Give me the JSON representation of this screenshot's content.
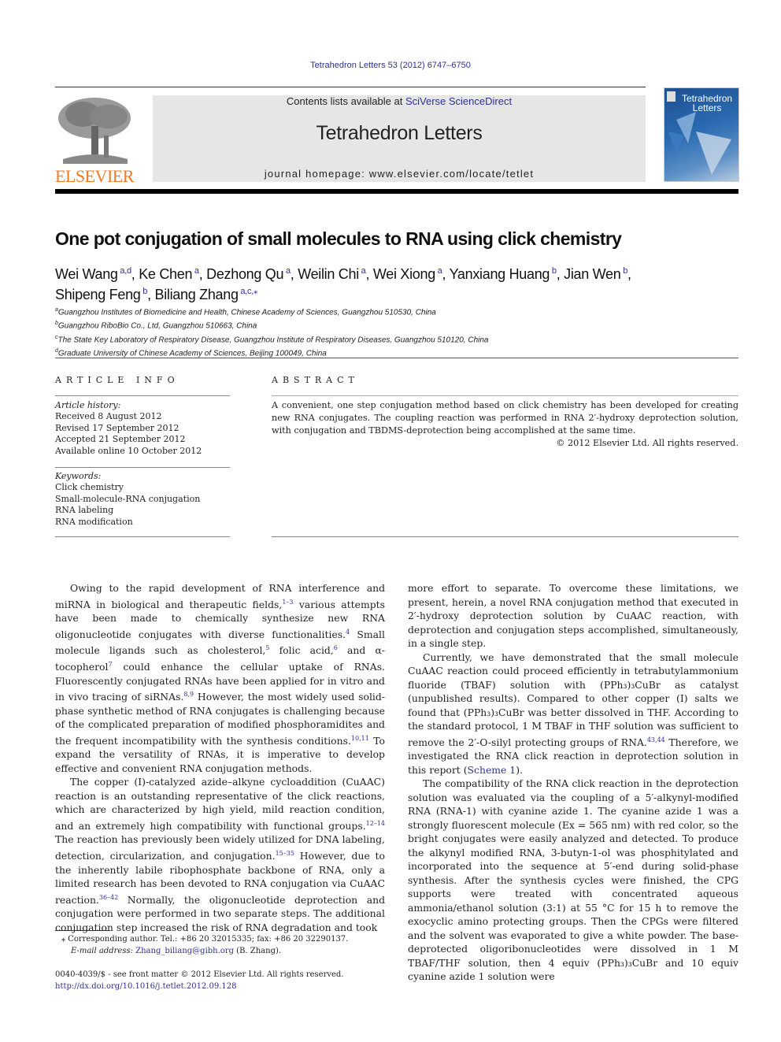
{
  "journal_header": {
    "citation": "Tetrahedron Letters 53 (2012) 6747–6750",
    "contents_prefix": "Contents lists available at ",
    "contents_link": "SciVerse ScienceDirect",
    "journal_title": "Tetrahedron Letters",
    "homepage_prefix": "journal homepage: ",
    "homepage_url": "www.elsevier.com/locate/tetlet",
    "publisher_logo_text": "ELSEVIER",
    "cover_title_line1": "Tetrahedron",
    "cover_title_line2": "Letters",
    "colors": {
      "link": "#2e3192",
      "elsevier_orange": "#f47920",
      "band": "#e6e6e6"
    }
  },
  "article": {
    "title": "One pot conjugation of small molecules to RNA using click chemistry",
    "authors": [
      {
        "name": "Wei Wang",
        "sup": "a,d"
      },
      {
        "name": "Ke Chen",
        "sup": "a"
      },
      {
        "name": "Dezhong Qu",
        "sup": "a"
      },
      {
        "name": "Weilin Chi",
        "sup": "a"
      },
      {
        "name": "Wei Xiong",
        "sup": "a"
      },
      {
        "name": "Yanxiang Huang",
        "sup": "b"
      },
      {
        "name": "Jian Wen",
        "sup": "b"
      },
      {
        "name": "Shipeng Feng",
        "sup": "b"
      },
      {
        "name": "Biliang Zhang",
        "sup": "a,c,⁎"
      }
    ],
    "affiliations": [
      {
        "mark": "a",
        "text": "Guangzhou Institutes of Biomedicine and Health, Chinese Academy of Sciences, Guangzhou 510530, China"
      },
      {
        "mark": "b",
        "text": "Guangzhou RiboBio Co., Ltd, Guangzhou 510663, China"
      },
      {
        "mark": "c",
        "text": "The State Key Laboratory of Respiratory Disease, Guangzhou Institute of Respiratory Diseases, Guangzhou 510120, China"
      },
      {
        "mark": "d",
        "text": "Graduate University of Chinese Academy of Sciences, Beijing 100049, China"
      }
    ]
  },
  "article_info": {
    "heading": "ARTICLE INFO",
    "history_label": "Article history:",
    "history": [
      "Received 8 August 2012",
      "Revised 17 September 2012",
      "Accepted 21 September 2012",
      "Available online 10 October 2012"
    ],
    "keywords_label": "Keywords:",
    "keywords": [
      "Click chemistry",
      "Small-molecule-RNA conjugation",
      "RNA labeling",
      "RNA modification"
    ]
  },
  "abstract": {
    "heading": "ABSTRACT",
    "text": "A convenient, one step conjugation method based on click chemistry has been developed for creating new RNA conjugates. The coupling reaction was performed in RNA 2′-hydroxy deprotection solution, with conjugation and TBDMS-deprotection being accomplished at the same time.",
    "copyright": "© 2012 Elsevier Ltd. All rights reserved."
  },
  "body": {
    "left": {
      "p1": [
        "Owing to the rapid development of RNA interference and miRNA in biological and therapeutic fields,",
        "1–3",
        " various attempts have been made to chemically synthesize new RNA oligonucleotide conjugates with diverse functionalities.",
        "4",
        " Small molecule ligands such as cholesterol,",
        "5",
        " folic acid,",
        "6",
        " and α-tocopherol",
        "7",
        " could enhance the cellular uptake of RNAs. Fluorescently conjugated RNAs have been applied for in vitro and in vivo tracing of siRNAs.",
        "8,9",
        " However, the most widely used solid-phase synthetic method of RNA conjugates is challenging because of the complicated preparation of modified phosphoramidites and the frequent incompatibility with the synthesis conditions.",
        "10,11",
        " To expand the versatility of RNAs, it is imperative to develop effective and convenient RNA conjugation methods."
      ],
      "p2": [
        "The copper (I)-catalyzed azide–alkyne cycloaddition (CuAAC) reaction is an outstanding representative of the click reactions, which are characterized by high yield, mild reaction condition, and an extremely high compatibility with functional groups.",
        "12–14",
        " The reaction has previously been widely utilized for DNA labeling, detection, circularization, and conjugation.",
        "15–35",
        " However, due to the inherently labile ribophosphate backbone of RNA, only a limited research has been devoted to RNA conjugation via CuAAC reaction.",
        "36–42",
        " Normally, the oligonucleotide deprotection and conjugation were performed in two separate steps. The additional conjugation step increased the risk of RNA degradation and took"
      ]
    },
    "right": {
      "p1": "more effort to separate. To overcome these limitations, we present, herein, a novel RNA conjugation method that executed in 2′-hydroxy deprotection solution by CuAAC reaction, with deprotection and conjugation steps accomplished, simultaneously, in a single step.",
      "p2": [
        "Currently, we have demonstrated that the small molecule CuAAC reaction could proceed efficiently in tetrabutylammonium fluoride (TBAF) solution with (PPh₃)₃CuBr as catalyst (unpublished results). Compared to other copper (I) salts we found that (PPh₃)₃CuBr was better dissolved in THF. According to the standard protocol, 1 M TBAF in THF solution was sufficient to remove the 2′-O-silyl protecting groups of RNA.",
        "43,44",
        " Therefore, we investigated the RNA click reaction in deprotection solution in this report (",
        "Scheme 1",
        ")."
      ],
      "p3": "The compatibility of the RNA click reaction in the deprotection solution was evaluated via the coupling of a 5′-alkynyl-modified RNA (RNA-1) with cyanine azide 1. The cyanine azide 1 was a strongly fluorescent molecule (Ex = 565 nm) with red color, so the bright conjugates were easily analyzed and detected. To produce the alkynyl modified RNA, 3-butyn-1-ol was phosphitylated and incorporated into the sequence at 5′-end during solid-phase synthesis. After the synthesis cycles were finished, the CPG supports were treated with concentrated aqueous ammonia/ethanol solution (3:1) at 55 °C for 15 h to remove the exocyclic amino protecting groups. Then the CPGs were filtered and the solvent was evaporated to give a white powder. The base-deprotected oligoribonucleotides were dissolved in 1 M TBAF/THF solution, then 4 equiv (PPh₃)₃CuBr and 10 equiv cyanine azide 1 solution were"
    }
  },
  "footnotes": {
    "corresponding": "⁎ Corresponding author. Tel.: +86 20 32015335; fax: +86 20 32290137.",
    "email_label": "E-mail address: ",
    "email": "Zhang_biliang@gibh.org",
    "email_suffix": " (B. Zhang).",
    "issn": "0040-4039/$ - see front matter © 2012 Elsevier Ltd. All rights reserved.",
    "doi": "http://dx.doi.org/10.1016/j.tetlet.2012.09.128"
  }
}
